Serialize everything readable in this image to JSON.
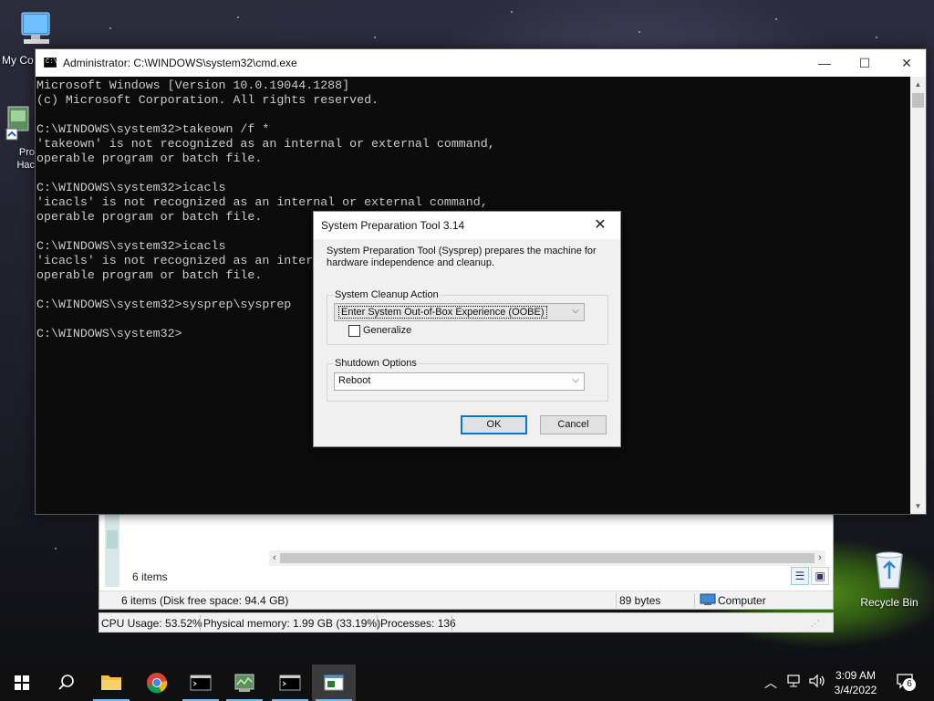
{
  "desktop": {
    "icons": [
      {
        "label": "My Co",
        "icon": "computer-icon"
      },
      {
        "label": "Pro Hac",
        "icon": "program-icon"
      },
      {
        "label": "Recycle Bin",
        "icon": "recycle-bin-icon"
      }
    ]
  },
  "cmd": {
    "title": "Administrator: C:\\WINDOWS\\system32\\cmd.exe",
    "lines": [
      "Microsoft Windows [Version 10.0.19044.1288]",
      "(c) Microsoft Corporation. All rights reserved.",
      "",
      "C:\\WINDOWS\\system32>takeown /f *",
      "'takeown' is not recognized as an internal or external command,",
      "operable program or batch file.",
      "",
      "C:\\WINDOWS\\system32>icacls",
      "'icacls' is not recognized as an internal or external command,",
      "operable program or batch file.",
      "",
      "C:\\WINDOWS\\system32>icacls",
      "'icacls' is not recognized as an internal or external command,",
      "operable program or batch file.",
      "",
      "C:\\WINDOWS\\system32>sysprep\\sysprep",
      "",
      "C:\\WINDOWS\\system32>"
    ]
  },
  "sysprep": {
    "title": "System Preparation Tool 3.14",
    "description": "System Preparation Tool (Sysprep) prepares the machine for hardware independence and cleanup.",
    "cleanup_label": "System Cleanup Action",
    "cleanup_value": "Enter System Out-of-Box Experience (OOBE)",
    "generalize_label": "Generalize",
    "generalize_checked": false,
    "shutdown_label": "Shutdown Options",
    "shutdown_value": "Reboot",
    "ok_label": "OK",
    "cancel_label": "Cancel"
  },
  "explorer": {
    "items_count": "6 items",
    "status_items": "6 items (Disk free space: 94.4 GB)",
    "status_size": "89 bytes",
    "status_location": "Computer"
  },
  "taskmgr": {
    "cpu": "CPU Usage: 53.52%",
    "memory": "Physical memory: 1.99 GB (33.19%)",
    "processes": "Processes: 136"
  },
  "taskbar": {
    "time": "3:09 AM",
    "date": "3/4/2022",
    "notification_count": "6"
  }
}
